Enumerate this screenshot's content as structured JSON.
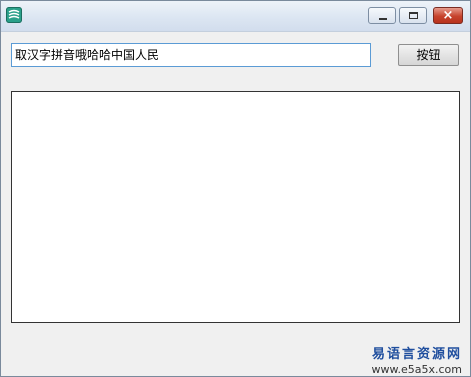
{
  "window": {
    "title": "",
    "icon": "app-icon",
    "controls": {
      "minimize": "minimize-icon",
      "maximize": "maximize-icon",
      "close": "×"
    }
  },
  "form": {
    "input_value": "取汉字拼音哦哈哈中国人民",
    "button_label": "按钮",
    "output_text": ""
  },
  "watermark": {
    "chinese": "易语言资源网",
    "url": "www.e5a5x.com"
  }
}
